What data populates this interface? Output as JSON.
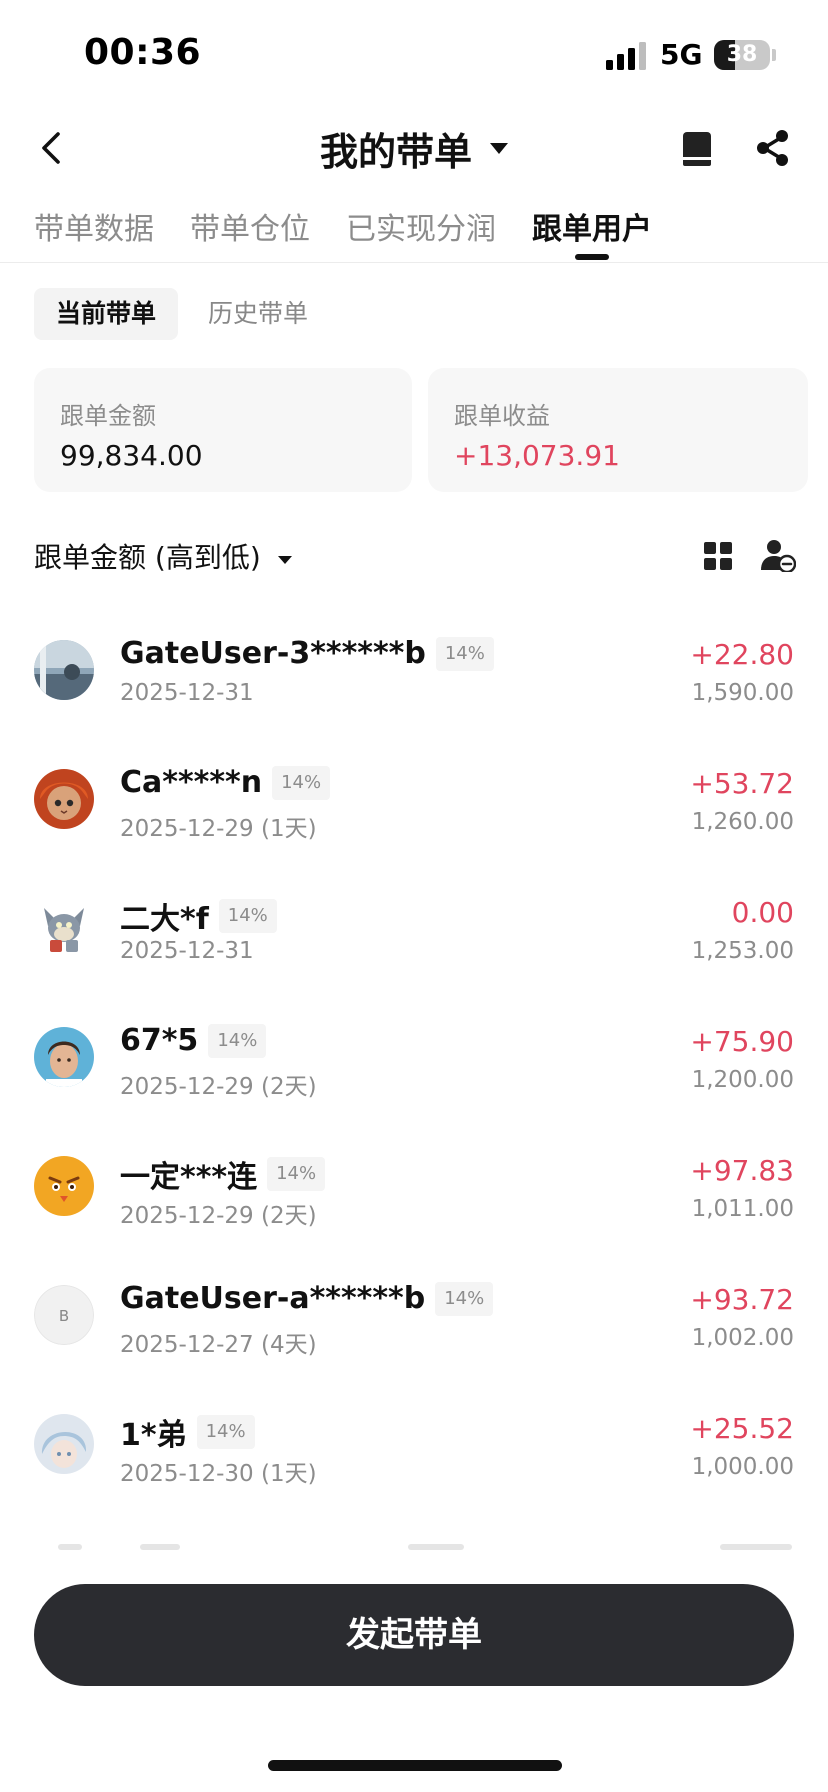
{
  "status_bar": {
    "time": "00:36",
    "network": "5G",
    "battery": "38",
    "battery_level_percent": 38
  },
  "header": {
    "title": "我的带单"
  },
  "tabs": [
    {
      "label": "带单数据",
      "active": false
    },
    {
      "label": "带单仓位",
      "active": false
    },
    {
      "label": "已实现分润",
      "active": false
    },
    {
      "label": "跟单用户",
      "active": true
    }
  ],
  "segment": {
    "current": "当前带单",
    "history": "历史带单"
  },
  "summary": {
    "amount_label": "跟单金额",
    "amount_value": "99,834.00",
    "profit_label": "跟单收益",
    "profit_value": "+13,073.91"
  },
  "sort": {
    "label": "跟单金额 (高到低)"
  },
  "followers": [
    {
      "name": "GateUser-3******b",
      "ratio": "14%",
      "date": "2025-12-31",
      "profit": "+22.80",
      "amount": "1,590.00",
      "avatar": "photo-avatar"
    },
    {
      "name": "Ca*****n",
      "ratio": "14%",
      "date": "2025-12-29 (1天)",
      "profit": "+53.72",
      "amount": "1,260.00",
      "avatar": "cat-avatar"
    },
    {
      "name": "二大*f",
      "ratio": "14%",
      "date": "2025-12-31",
      "profit": "0.00",
      "amount": "1,253.00",
      "avatar": "cartoon-cat-avatar"
    },
    {
      "name": "67*5",
      "ratio": "14%",
      "date": "2025-12-29 (2天)",
      "profit": "+75.90",
      "amount": "1,200.00",
      "avatar": "man-avatar"
    },
    {
      "name": "一定***连",
      "ratio": "14%",
      "date": "2025-12-29 (2天)",
      "profit": "+97.83",
      "amount": "1,011.00",
      "avatar": "emoji-avatar"
    },
    {
      "name": "GateUser-a******b",
      "ratio": "14%",
      "date": "2025-12-27 (4天)",
      "profit": "+93.72",
      "amount": "1,002.00",
      "avatar": "letter-avatar",
      "avatar_letter": "B"
    },
    {
      "name": "1*弟",
      "ratio": "14%",
      "date": "2025-12-30 (1天)",
      "profit": "+25.52",
      "amount": "1,000.00",
      "avatar": "anime-avatar"
    }
  ],
  "colors": {
    "profit": "#e0455e",
    "muted": "#8c8c8c",
    "button": "#2b2c30"
  },
  "bottom": {
    "button_label": "发起带单"
  }
}
